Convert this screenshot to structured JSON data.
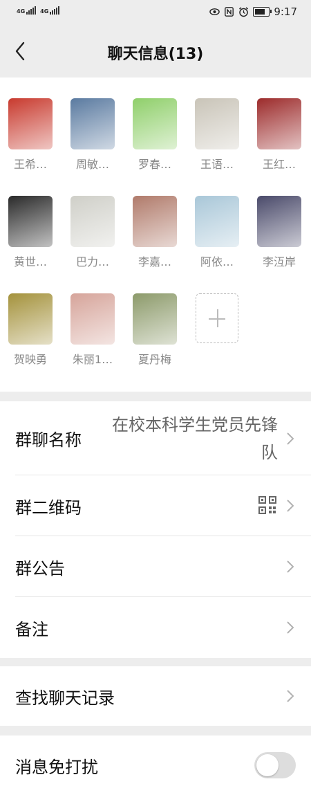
{
  "status_bar": {
    "sim1": "4G",
    "sim2": "4G",
    "time": "9:17",
    "icons": [
      "eye-icon",
      "nfc-icon",
      "alarm-icon",
      "battery-icon"
    ],
    "battery_level": 0.8
  },
  "navbar": {
    "title": "聊天信息(13)"
  },
  "members": [
    {
      "name": "王希…",
      "color": "#c83a2e"
    },
    {
      "name": "周敏…",
      "color": "#5a7aa0"
    },
    {
      "name": "罗春…",
      "color": "#8fcf6a"
    },
    {
      "name": "王语…",
      "color": "#c9c4b8"
    },
    {
      "name": "王红…",
      "color": "#9c2b2b"
    },
    {
      "name": "黄世…",
      "color": "#2a2a2a"
    },
    {
      "name": "巴力…",
      "color": "#cfcfc8"
    },
    {
      "name": "李嘉…",
      "color": "#b07a6a"
    },
    {
      "name": "阿依…",
      "color": "#a9c7d8"
    },
    {
      "name": "李沍岸",
      "color": "#4a4a6a"
    },
    {
      "name": "贺映勇",
      "color": "#a4923c"
    },
    {
      "name": "朱丽1…",
      "color": "#d6a49a"
    },
    {
      "name": "夏丹梅",
      "color": "#8c9a6a"
    }
  ],
  "settings": {
    "group_name": {
      "label": "群聊名称",
      "value": "在校本科学生党员先锋队"
    },
    "qr_code": {
      "label": "群二维码"
    },
    "announcement": {
      "label": "群公告"
    },
    "remark": {
      "label": "备注"
    },
    "search_history": {
      "label": "查找聊天记录"
    },
    "mute": {
      "label": "消息免打扰",
      "enabled": false
    }
  }
}
